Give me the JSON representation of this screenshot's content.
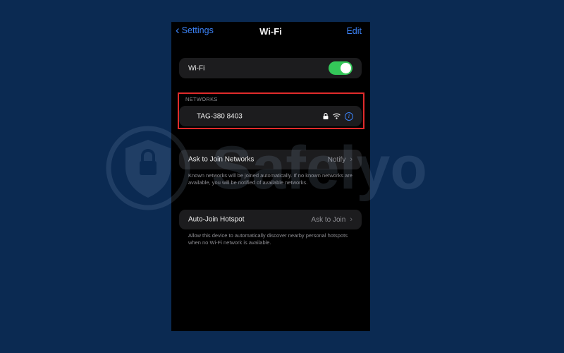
{
  "nav": {
    "back_label": "Settings",
    "title": "Wi-Fi",
    "edit_label": "Edit"
  },
  "wifi": {
    "label": "Wi-Fi",
    "enabled": true
  },
  "networks": {
    "header": "NETWORKS",
    "items": [
      {
        "name": "TAG-380 8403",
        "secured": true,
        "icons": [
          "lock-icon",
          "wifi-signal-icon",
          "info-icon"
        ]
      }
    ]
  },
  "ask_to_join": {
    "label": "Ask to Join Networks",
    "value": "Notify",
    "footnote": "Known networks will be joined automatically. If no known networks are available, you will be notified of available networks."
  },
  "auto_join": {
    "label": "Auto-Join Hotspot",
    "value": "Ask to Join",
    "footnote": "Allow this device to automatically discover nearby personal hotspots when no Wi-Fi network is available."
  },
  "watermark": {
    "text": "Safelyo"
  },
  "colors": {
    "background": "#0b2a52",
    "accent": "#3b82f6",
    "toggle_on": "#34c759",
    "highlight": "#e02b2b"
  }
}
